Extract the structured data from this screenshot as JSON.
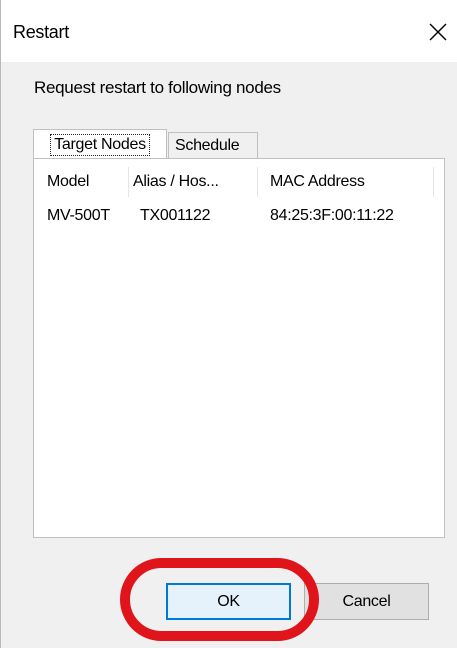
{
  "window": {
    "title": "Restart",
    "close_icon": "close-icon"
  },
  "instruction": "Request restart to following nodes",
  "tabs": [
    {
      "label": "Target Nodes",
      "active": true
    },
    {
      "label": "Schedule",
      "active": false
    }
  ],
  "table": {
    "columns": [
      "Model",
      "Alias / Hos...",
      "MAC Address"
    ],
    "rows": [
      [
        "MV-500T",
        "TX001122",
        "84:25:3F:00:11:22"
      ]
    ]
  },
  "buttons": {
    "ok": "OK",
    "cancel": "Cancel"
  },
  "colors": {
    "highlight": "#e0151c",
    "ok_border": "#0078d7"
  }
}
